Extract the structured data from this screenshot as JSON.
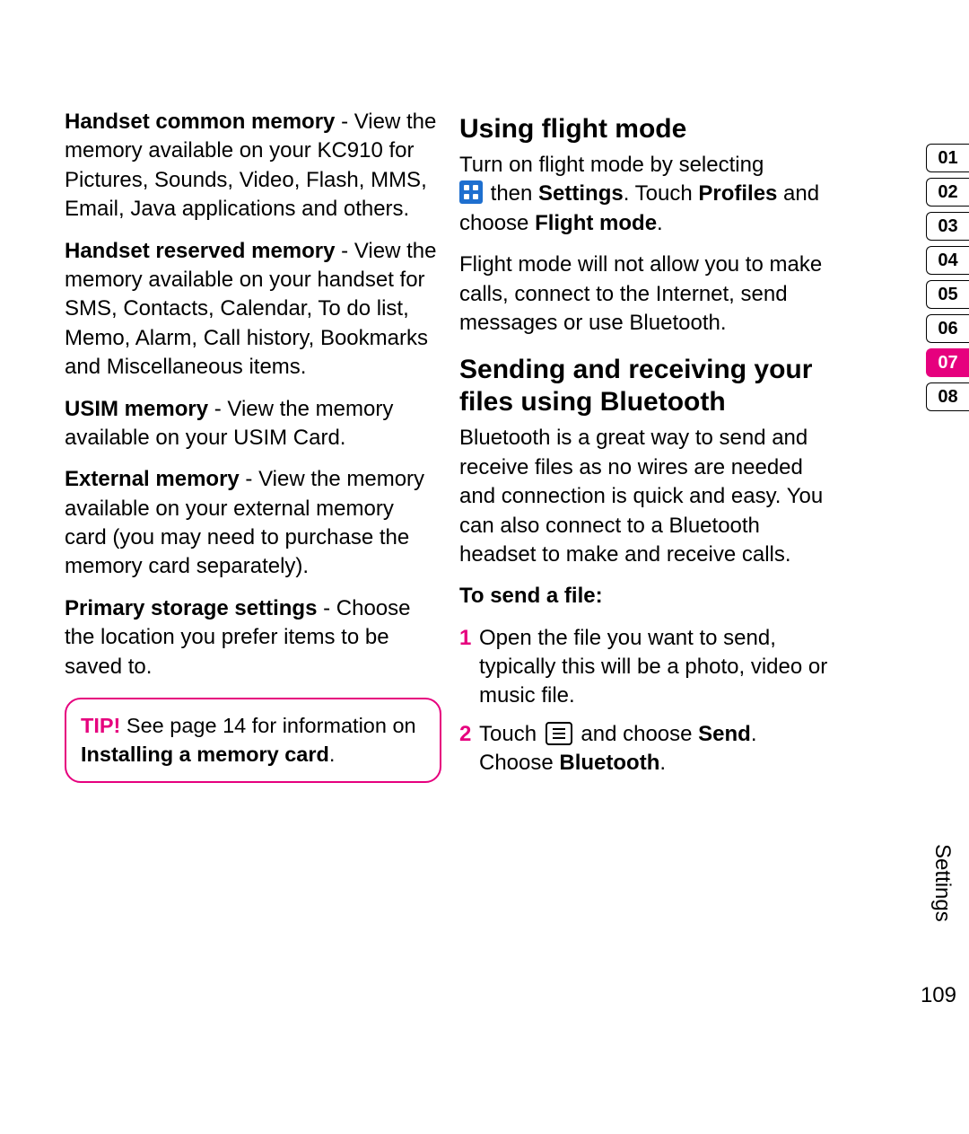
{
  "left": {
    "p1": {
      "bold": "Handset common memory",
      "rest": " - View the memory available on your KC910 for Pictures, Sounds, Video, Flash, MMS, Email, Java applications and others."
    },
    "p2": {
      "bold": "Handset reserved memory",
      "rest": " - View the memory available on your handset for SMS, Contacts, Calendar, To do list, Memo, Alarm, Call history, Bookmarks and Miscellaneous items."
    },
    "p3": {
      "bold": "USIM memory",
      "rest": " - View the memory available on your USIM Card."
    },
    "p4": {
      "bold": "External memory",
      "rest": " - View the memory available on your external memory card (you may need to purchase the memory card separately)."
    },
    "p5": {
      "bold": "Primary storage settings",
      "rest": " - Choose the location you prefer items to be saved to."
    },
    "tip": {
      "label": "TIP!",
      "text": " See page 14 for information on ",
      "bold": "Installing a memory card",
      "end": "."
    }
  },
  "right": {
    "h1": "Using flight mode",
    "fm1": "Turn on flight mode by selecting ",
    "fm2a": " then ",
    "fm2b": "Settings",
    "fm2c": ". Touch ",
    "fm2d": "Profiles",
    "fm2e": " and choose ",
    "fm2f": "Flight mode",
    "fm2g": ".",
    "fm3": "Flight mode will not allow you to make calls, connect to the Internet, send messages or use Bluetooth.",
    "h2": "Sending and receiving your files using Bluetooth",
    "bt1": "Bluetooth is a great way to send and receive files as no wires are needed and connection is quick and easy. You can also connect to a Bluetooth headset to make and receive calls.",
    "to_send": "To send a file:",
    "step1": {
      "num": "1",
      "text": "Open the file you want to send, typically this will be a photo, video or music file."
    },
    "step2": {
      "num": "2",
      "pre": "Touch ",
      "mid": " and choose ",
      "b1": "Send",
      "mid2": ". Choose ",
      "b2": "Bluetooth",
      "end": "."
    }
  },
  "tabs": [
    "01",
    "02",
    "03",
    "04",
    "05",
    "06",
    "07",
    "08"
  ],
  "active_tab": "07",
  "side_label": "Settings",
  "page_number": "109"
}
